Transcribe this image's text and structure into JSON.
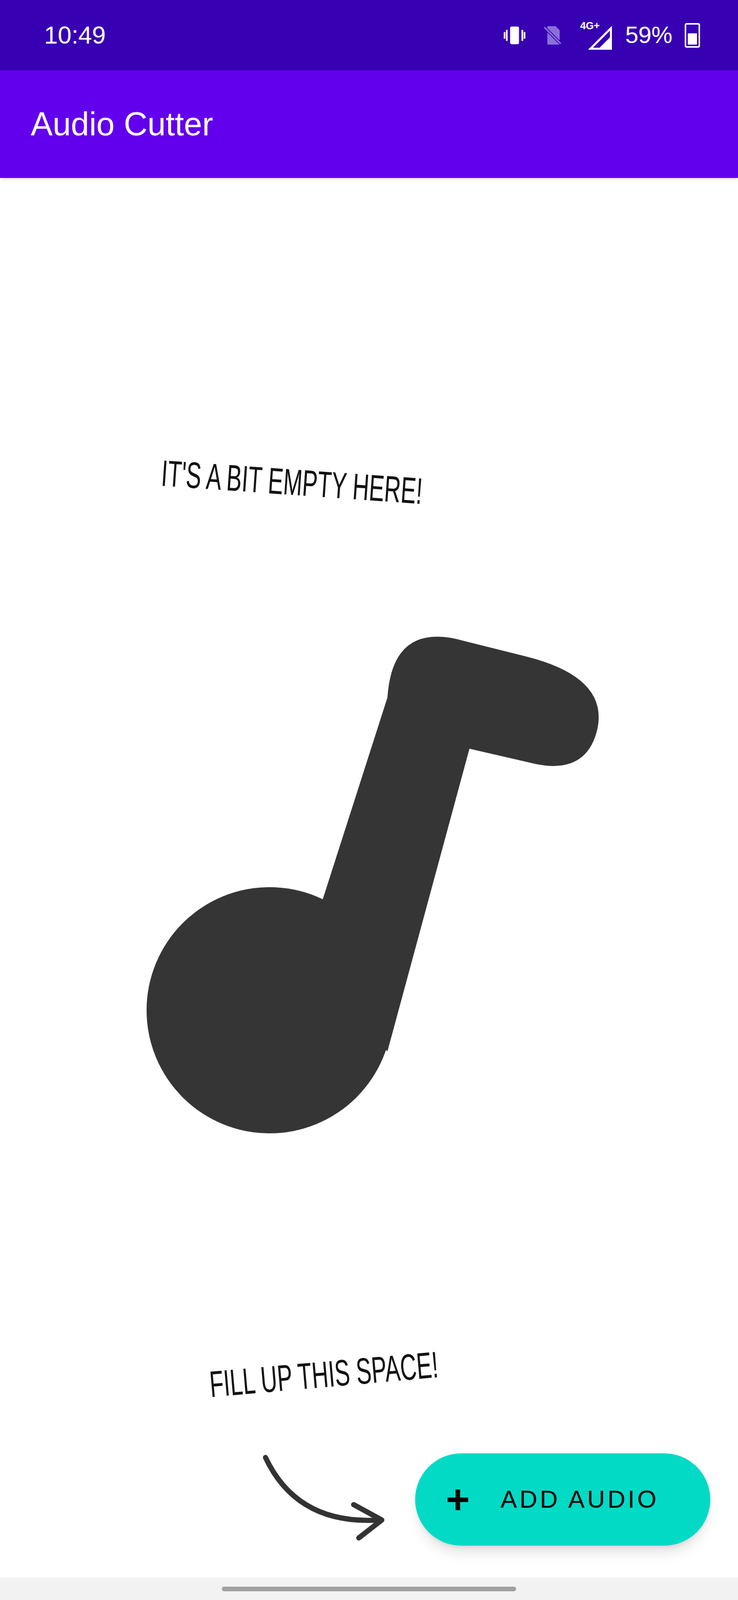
{
  "status_bar": {
    "time": "10:49",
    "network": "4G+",
    "battery": "59%",
    "battery_level": 0.59
  },
  "app_bar": {
    "title": "Audio Cutter"
  },
  "empty_state": {
    "headline": "IT'S A BIT EMPTY HERE!",
    "prompt": "FILL UP THIS SPACE!"
  },
  "fab": {
    "icon": "+",
    "label": "ADD AUDIO"
  }
}
